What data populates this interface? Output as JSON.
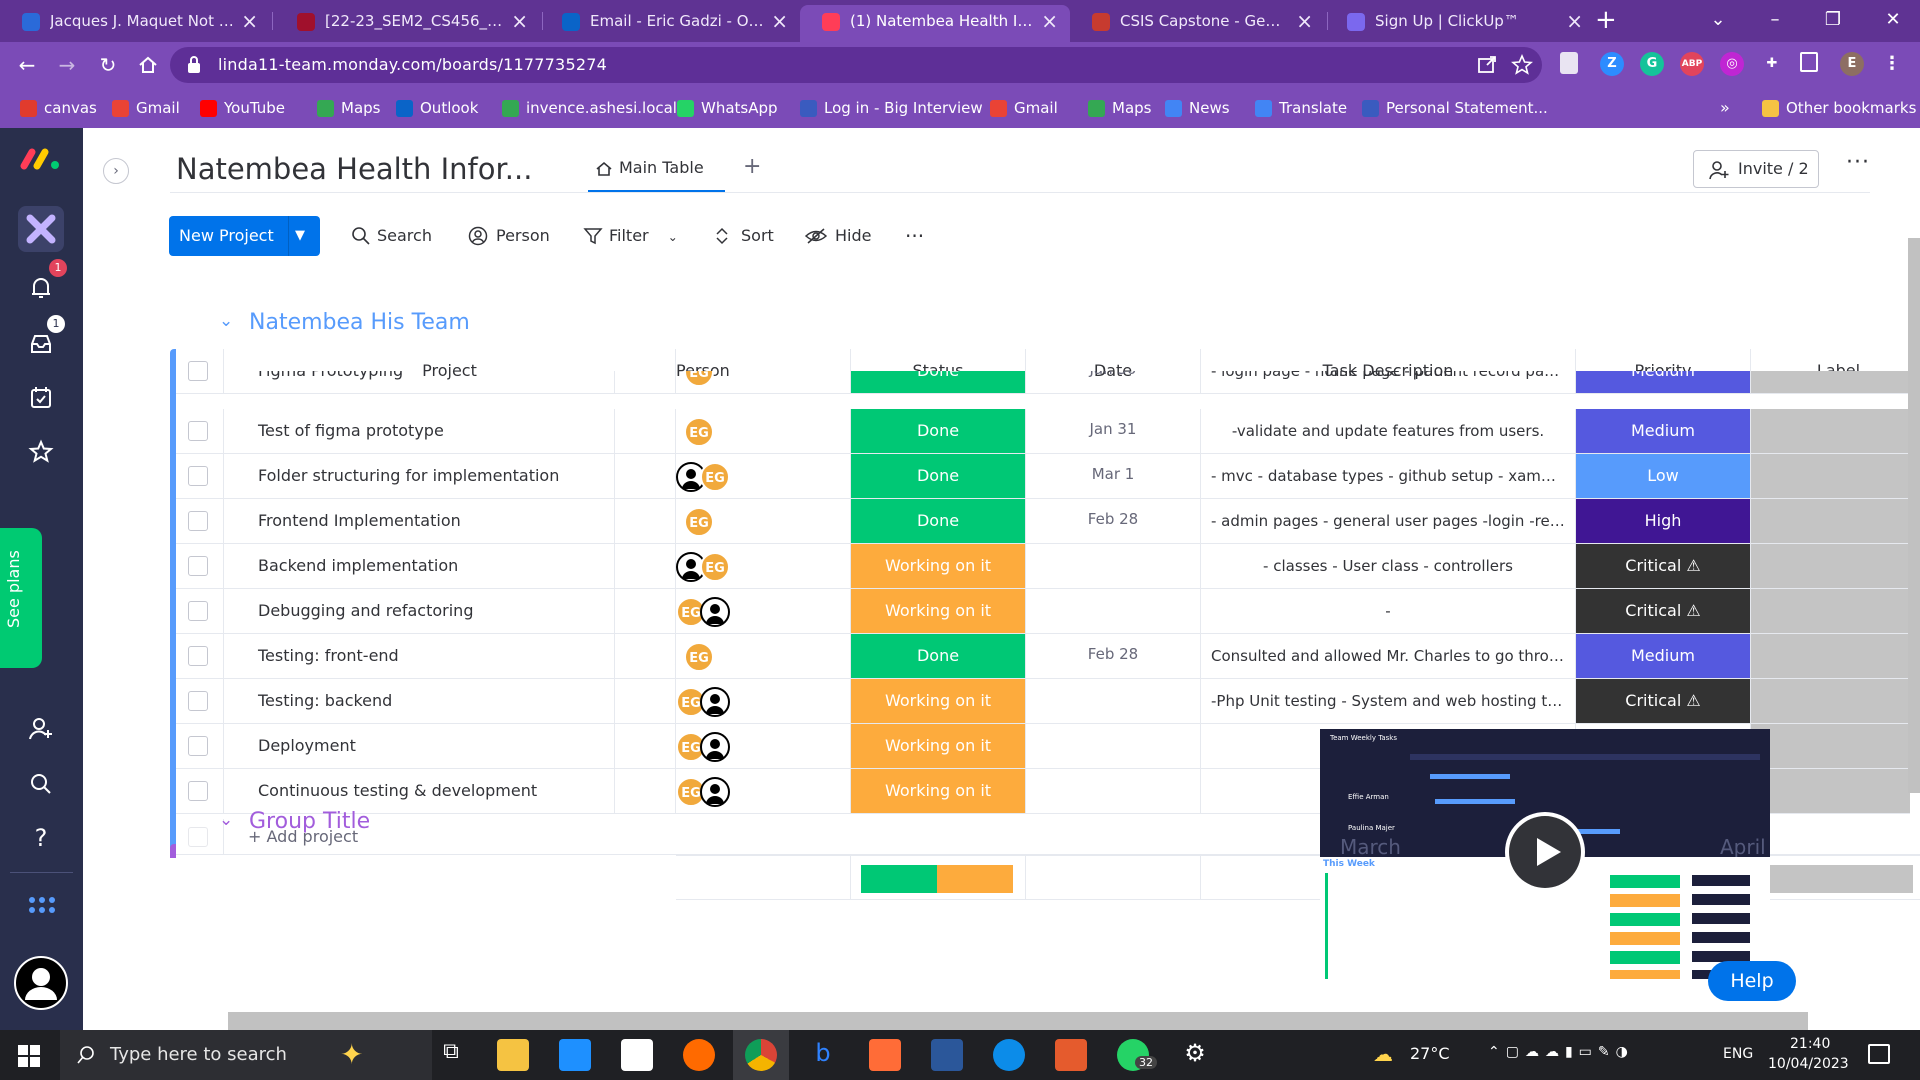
{
  "browser": {
    "tabs": [
      {
        "title": "Jacques J. Maquet Not Foun",
        "icon_color": "#2a6ad9",
        "active": false
      },
      {
        "title": "[22-23_SEM2_CS456_A] - Al",
        "icon_color": "#a0102c",
        "active": false
      },
      {
        "title": "Email - Eric Gadzi - Outlook",
        "icon_color": "#0a64c8",
        "active": false
      },
      {
        "title": "(1) Natembea Health Inform",
        "icon_color": "#ff3d57",
        "active": true
      },
      {
        "title": "CSIS Capstone - General Gu",
        "icon_color": "#c73b2f",
        "active": false
      },
      {
        "title": "Sign Up | ClickUp™",
        "icon_color": "#7b68ee",
        "active": false
      }
    ],
    "url": "linda11-team.monday.com/boards/1177735274",
    "profile_initial": "E",
    "bookmarks": [
      {
        "label": "canvas",
        "color": "#e13b2d"
      },
      {
        "label": "Gmail",
        "color": "#ea4335"
      },
      {
        "label": "YouTube",
        "color": "#ff0000"
      },
      {
        "label": "Maps",
        "color": "#34a853"
      },
      {
        "label": "Outlook",
        "color": "#0a64c8"
      },
      {
        "label": "invence.ashesi.local",
        "color": "#34a853"
      },
      {
        "label": "WhatsApp",
        "color": "#25d366"
      },
      {
        "label": "Log in - Big Interview",
        "color": "#3a5bbf"
      },
      {
        "label": "Gmail",
        "color": "#ea4335"
      },
      {
        "label": "Maps",
        "color": "#34a853"
      },
      {
        "label": "News",
        "color": "#4285f4"
      },
      {
        "label": "Translate",
        "color": "#4285f4"
      },
      {
        "label": "Personal Statement...",
        "color": "#3a5bbf"
      }
    ],
    "other_bookmarks": "Other bookmarks",
    "overflow": "»"
  },
  "sidebar": {
    "notif_count": "1",
    "inbox_count": "1",
    "see_plans": "See plans"
  },
  "board": {
    "title": "Natembea Health Infor...",
    "main_tab": "Main Table",
    "add_view": "+",
    "invite": "Invite / 2",
    "more": "···",
    "new_project": "New Project",
    "tools": {
      "search": "Search",
      "person": "Person",
      "filter": "Filter",
      "sort": "Sort",
      "hide": "Hide",
      "more": "···"
    },
    "group_title": "Natembea His Team",
    "group_title_2": "Group Title",
    "add_item": "+ Add project",
    "columns": [
      "Project",
      "Person",
      "Status",
      "Date",
      "Task Description",
      "Priority",
      "Label"
    ],
    "rows": [
      {
        "project": "Figma Prototyping",
        "people": [
          "EG"
        ],
        "status": "Done",
        "date": "Jan 30",
        "desc": "- login page - home page - patient record page...",
        "priority": "Medium"
      },
      {
        "project": "Test of figma prototype",
        "people": [
          "EG"
        ],
        "status": "Done",
        "date": "Jan 31",
        "desc": "-validate and update features from users.",
        "priority": "Medium"
      },
      {
        "project": "Folder structuring for implementation",
        "people": [
          "photo",
          "EG"
        ],
        "status": "Done",
        "date": "Mar 1",
        "desc": "- mvc - database types - github setup - xampp ...",
        "priority": "Low"
      },
      {
        "project": "Frontend Implementation",
        "people": [
          "EG"
        ],
        "status": "Done",
        "date": "Feb 28",
        "desc": "- admin pages - general user pages -login -regi...",
        "priority": "High"
      },
      {
        "project": "Backend implementation",
        "people": [
          "photo",
          "EG"
        ],
        "status": "Working on it",
        "date": "",
        "desc": "- classes - User class - controllers",
        "priority": "Critical ⚠"
      },
      {
        "project": "Debugging and refactoring",
        "people": [
          "EG",
          "photo"
        ],
        "status": "Working on it",
        "date": "",
        "desc": "-",
        "priority": "Critical ⚠"
      },
      {
        "project": "Testing: front-end",
        "people": [
          "EG"
        ],
        "status": "Done",
        "date": "Feb 28",
        "desc": "Consulted and allowed Mr. Charles to go throu...",
        "priority": "Medium"
      },
      {
        "project": "Testing: backend",
        "people": [
          "EG",
          "photo"
        ],
        "status": "Working on it",
        "date": "",
        "desc": "-Php Unit testing - System and web hosting te...",
        "priority": "Critical ⚠"
      },
      {
        "project": "Deployment",
        "people": [
          "EG",
          "photo"
        ],
        "status": "Working on it",
        "date": "",
        "desc": "",
        "priority": ""
      },
      {
        "project": "Continuous testing & development",
        "people": [
          "EG",
          "photo"
        ],
        "status": "Working on it",
        "date": "",
        "desc": "",
        "priority": ""
      }
    ],
    "status_summary": {
      "done_fraction": 0.5,
      "working_fraction": 0.5
    },
    "colors": {
      "Done": "#00c875",
      "Working on it": "#fdab3d",
      "Medium": "#5559df",
      "Low": "#579bfc",
      "High": "#401694",
      "Critical ⚠": "#333333",
      "group": "#579bfc",
      "group2": "#a25ddc"
    }
  },
  "video": {
    "title": "Team Weekly Tasks",
    "week_label": "This Week",
    "month_left": "March",
    "month_right": "April",
    "person_1": "Effie Arman",
    "person_2": "Paulina Majer"
  },
  "help": "Help",
  "taskbar": {
    "search_placeholder": "Type here to search",
    "weather": "27°C",
    "language": "ENG",
    "time": "21:40",
    "date": "10/04/2023",
    "whatsapp_badge": "32"
  }
}
